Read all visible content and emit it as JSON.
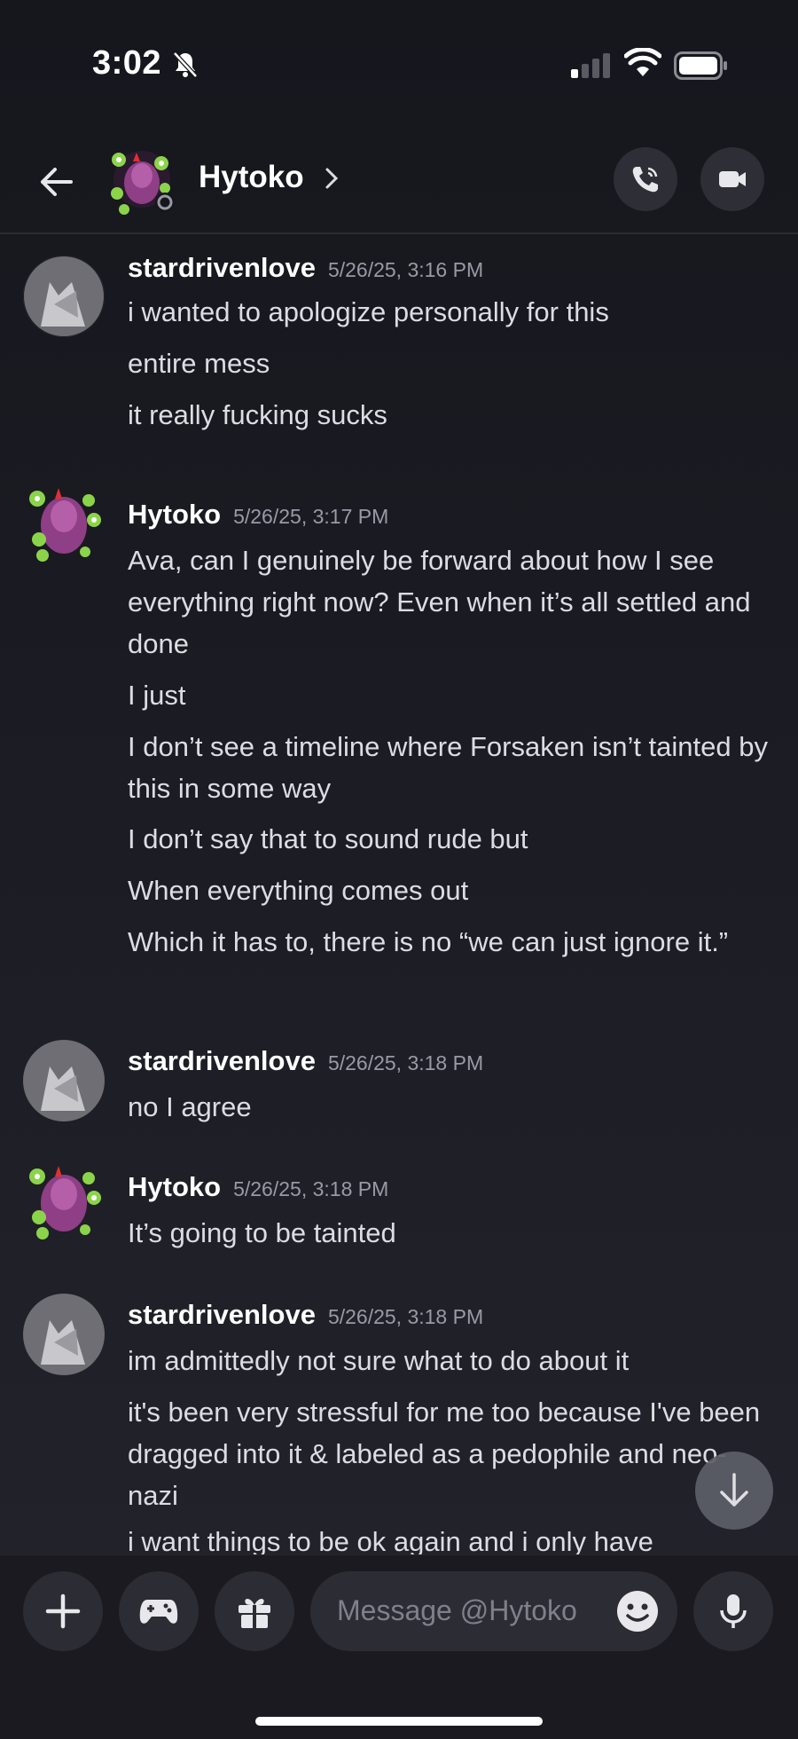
{
  "status_bar": {
    "time": "3:02"
  },
  "header": {
    "contact_name": "Hytoko"
  },
  "messages": [
    {
      "author": "stardrivenlove",
      "timestamp": "5/26/25, 3:16 PM",
      "lines": [
        "i wanted to apologize personally for this",
        "entire mess",
        "it really fucking sucks"
      ]
    },
    {
      "author": "Hytoko",
      "timestamp": "5/26/25, 3:17 PM",
      "lines": [
        "Ava, can I genuinely be forward about how I see everything right now? Even when it’s all settled and done",
        "I just",
        "I don’t see a timeline where Forsaken isn’t tainted by this in some way",
        "I don’t say that to sound rude but",
        "When everything comes out",
        "Which it has to, there is no “we can just ignore it.”"
      ]
    },
    {
      "author": "stardrivenlove",
      "timestamp": "5/26/25, 3:18 PM",
      "lines": [
        "no I agree"
      ]
    },
    {
      "author": "Hytoko",
      "timestamp": "5/26/25, 3:18 PM",
      "lines": [
        "It’s going to be tainted"
      ]
    },
    {
      "author": "stardrivenlove",
      "timestamp": "5/26/25, 3:18 PM",
      "lines": [
        "im admittedly not sure what to do about it",
        "it's been very stressful for me too because I've been dragged into it & labeled as a pedophile and neo-nazi",
        "i want things to be ok again and i only have"
      ]
    }
  ],
  "composer": {
    "placeholder": "Message @Hytoko"
  },
  "icons": {
    "back": "arrow-left-icon",
    "call": "phone-icon",
    "video": "video-camera-icon",
    "plus": "plus-icon",
    "game": "gamepad-icon",
    "gift": "gift-icon",
    "emoji": "emoji-icon",
    "mic": "microphone-icon",
    "scroll": "arrow-down-icon"
  },
  "colors": {
    "background": "#1b1b23",
    "text": "#dcdce2",
    "timestamp": "#9a9aa5",
    "avatar_accent": "#8e3f86",
    "flower": "#8bd44a"
  }
}
